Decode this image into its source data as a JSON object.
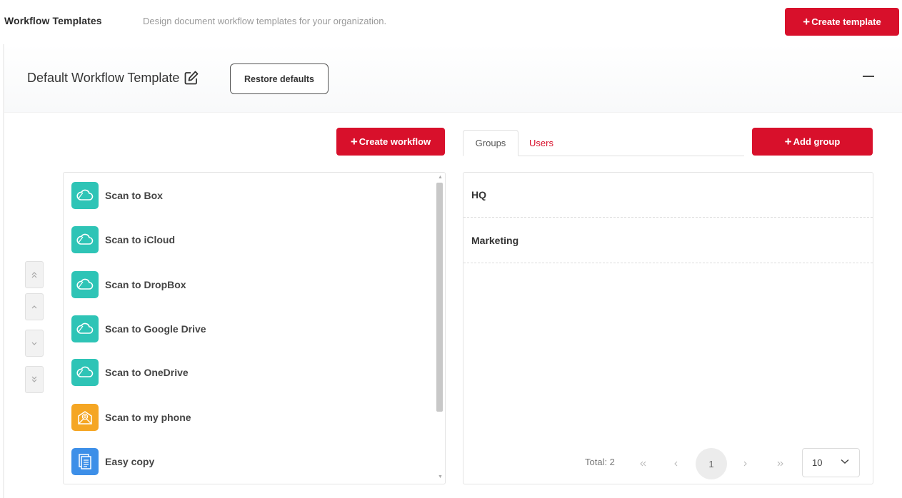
{
  "header": {
    "title": "Workflow Templates",
    "subtitle": "Design document workflow templates for your organization.",
    "create_template_label": "Create template"
  },
  "template": {
    "name": "Default Workflow Template",
    "restore_label": "Restore defaults"
  },
  "workflows": {
    "create_label": "Create workflow",
    "items": [
      {
        "label": "Scan to Box",
        "icon": "cloud-icon",
        "color": "#2ec4b6"
      },
      {
        "label": "Scan to iCloud",
        "icon": "cloud-icon",
        "color": "#2ec4b6"
      },
      {
        "label": "Scan to DropBox",
        "icon": "cloud-icon",
        "color": "#2ec4b6"
      },
      {
        "label": "Scan to Google Drive",
        "icon": "cloud-icon",
        "color": "#2ec4b6"
      },
      {
        "label": "Scan to OneDrive",
        "icon": "cloud-icon",
        "color": "#2ec4b6"
      },
      {
        "label": "Scan to my phone",
        "icon": "email-at-icon",
        "color": "#f5a623"
      },
      {
        "label": "Easy copy",
        "icon": "document-copy-icon",
        "color": "#3d8fe8"
      }
    ]
  },
  "tabs": {
    "groups_label": "Groups",
    "users_label": "Users",
    "active": "Groups"
  },
  "groups": {
    "add_label": "Add group",
    "items": [
      "HQ",
      "Marketing"
    ]
  },
  "pagination": {
    "total_text": "Total: 2",
    "current_page": "1",
    "page_size": "10"
  },
  "colors": {
    "accent": "#d8102b",
    "cloud_icon_bg": "#2ec4b6",
    "phone_icon_bg": "#f5a623",
    "copy_icon_bg": "#3d8fe8"
  }
}
